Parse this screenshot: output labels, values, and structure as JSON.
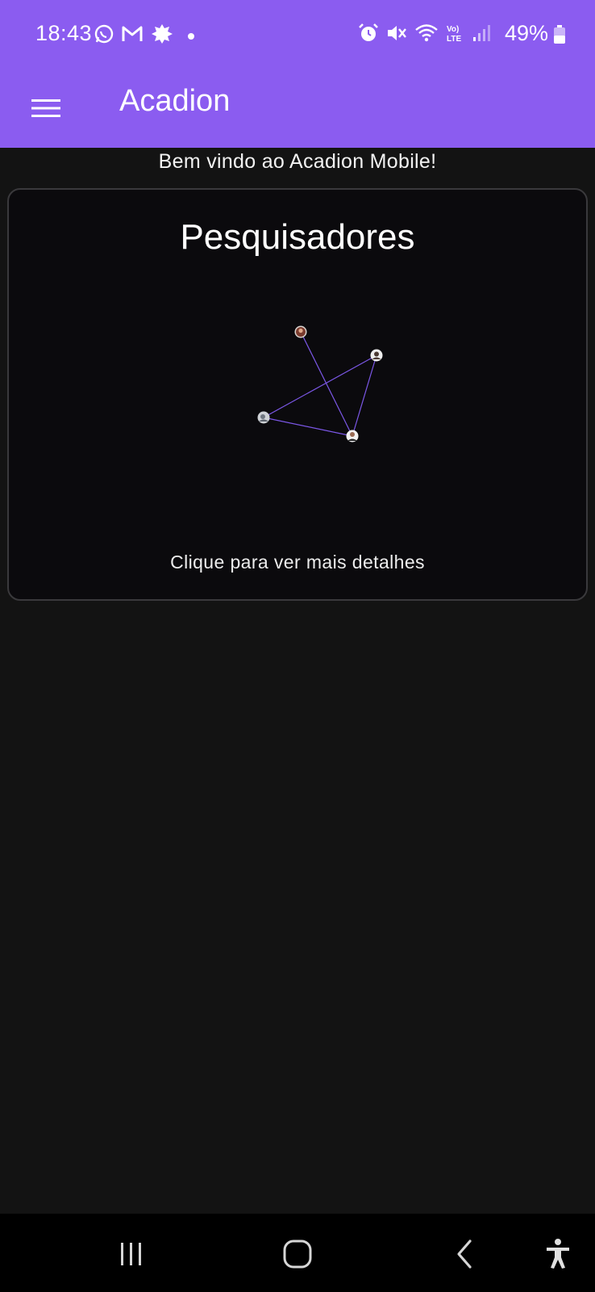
{
  "status_bar": {
    "time": "18:43",
    "battery": "49%",
    "left_icons": [
      "whatsapp-icon",
      "gmail-icon",
      "app-notification-icon",
      "dot-icon"
    ],
    "right_icons": [
      "alarm-icon",
      "mute-icon",
      "wifi-icon",
      "volte-icon",
      "signal-icon",
      "battery-icon"
    ]
  },
  "app_bar": {
    "title": "Acadion",
    "menu_icon": "hamburger-menu-icon",
    "color": "#8b5cf0"
  },
  "main": {
    "welcome": "Bem vindo ao Acadion Mobile!",
    "card": {
      "title": "Pesquisadores",
      "hint": "Clique para ver mais detalhes",
      "edge_color": "#7b57e6",
      "nodes": [
        "researcher-a",
        "researcher-b",
        "researcher-c",
        "researcher-d"
      ]
    }
  },
  "nav_bar": {
    "icons": [
      "recent-apps-icon",
      "home-icon",
      "back-icon",
      "accessibility-icon"
    ]
  }
}
